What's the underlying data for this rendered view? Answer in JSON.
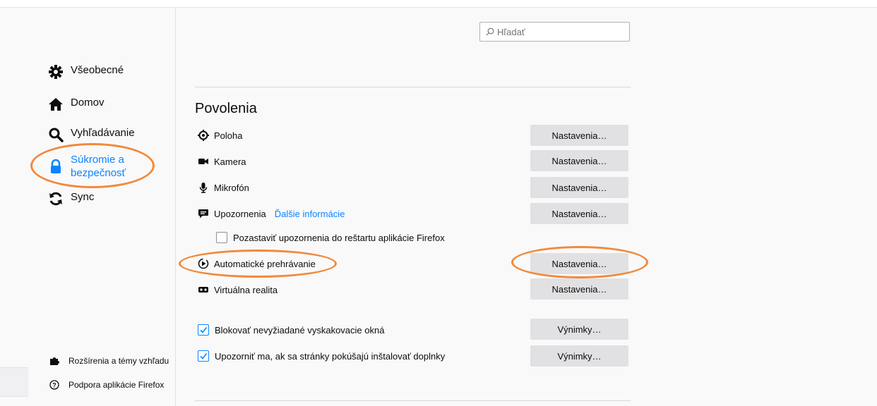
{
  "search": {
    "placeholder": "Hľadať"
  },
  "sidebar": {
    "items": [
      {
        "label": "Všeobecné",
        "icon": "gear-icon"
      },
      {
        "label": "Domov",
        "icon": "home-icon"
      },
      {
        "label": "Vyhľadávanie",
        "icon": "search-icon"
      },
      {
        "label": "Súkromie a bezpečnosť",
        "icon": "lock-icon",
        "selected": true
      },
      {
        "label": "Sync",
        "icon": "sync-icon"
      }
    ],
    "footer": [
      {
        "label": "Rozšírenia a témy vzhľadu",
        "icon": "puzzle-icon"
      },
      {
        "label": "Podpora aplikácie Firefox",
        "icon": "help-icon"
      }
    ]
  },
  "permissions": {
    "title": "Povolenia",
    "rows": [
      {
        "label": "Poloha",
        "icon": "location-icon",
        "button": "Nastavenia…"
      },
      {
        "label": "Kamera",
        "icon": "camera-icon",
        "button": "Nastavenia…"
      },
      {
        "label": "Mikrofón",
        "icon": "microphone-icon",
        "button": "Nastavenia…"
      },
      {
        "label": "Upozornenia",
        "icon": "notification-icon",
        "link": "Ďalšie informácie",
        "button": "Nastavenia…"
      },
      {
        "label": "Automatické prehrávanie",
        "icon": "autoplay-icon",
        "button": "Nastavenia…"
      },
      {
        "label": "Virtuálna realita",
        "icon": "vr-icon",
        "button": "Nastavenia…"
      }
    ],
    "pause_notifications": {
      "label": "Pozastaviť upozornenia do reštartu aplikácie Firefox",
      "checked": false
    },
    "block_popups": {
      "label": "Blokovať nevyžiadané vyskakovacie okná",
      "checked": true,
      "button": "Výnimky…"
    },
    "warn_addons": {
      "label": "Upozorniť ma, ak sa stránky pokúšajú inštalovať doplnky",
      "checked": true,
      "button": "Výnimky…"
    }
  },
  "colors": {
    "accent": "#0a84ff",
    "annotation": "#f3893a"
  }
}
